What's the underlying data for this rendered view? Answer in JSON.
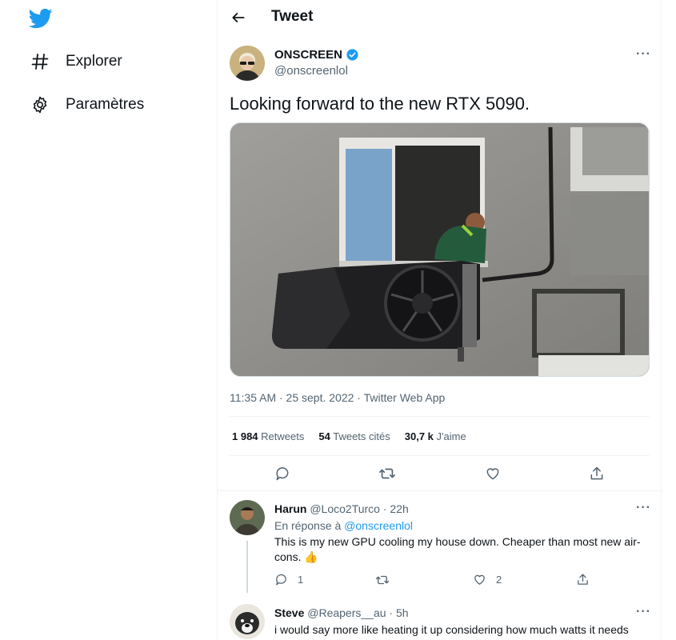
{
  "nav": {
    "logo_icon": "twitter-bird-icon",
    "items": [
      {
        "icon": "hashtag-icon",
        "label": "Explorer"
      },
      {
        "icon": "gear-icon",
        "label": "Paramètres"
      }
    ]
  },
  "header": {
    "title": "Tweet",
    "back_icon": "arrow-left-icon"
  },
  "tweet": {
    "author_name": "ONSCREEN",
    "author_handle": "@onscreenlol",
    "text": "Looking forward to the new RTX 5090.",
    "meta": "11:35 AM · 25 sept. 2022 · Twitter Web App",
    "stats": {
      "retweets_count": "1 984",
      "retweets_label": "Retweets",
      "quotes_count": "54",
      "quotes_label": "Tweets cités",
      "likes_count": "30,7 k",
      "likes_label": "J'aime"
    }
  },
  "replies": [
    {
      "name": "Harun",
      "handle_time": "@Loco2Turco · 22h",
      "reply_to_prefix": "En réponse à",
      "reply_to_handle": "@onscreenlol",
      "text_line1": "This is my new GPU cooling my house down. Cheaper than most new air-",
      "text_line2": "cons. 👍",
      "reply_count": "1",
      "like_count": "2"
    },
    {
      "name": "Steve",
      "handle_time": "@Reapers__au · 5h",
      "text_line1": "i would say more like heating it up considering how much watts it needs"
    }
  ],
  "colors": {
    "accent": "#1d9bf0",
    "text": "#0f1419",
    "muted": "#536471",
    "border": "#eff3f4"
  }
}
